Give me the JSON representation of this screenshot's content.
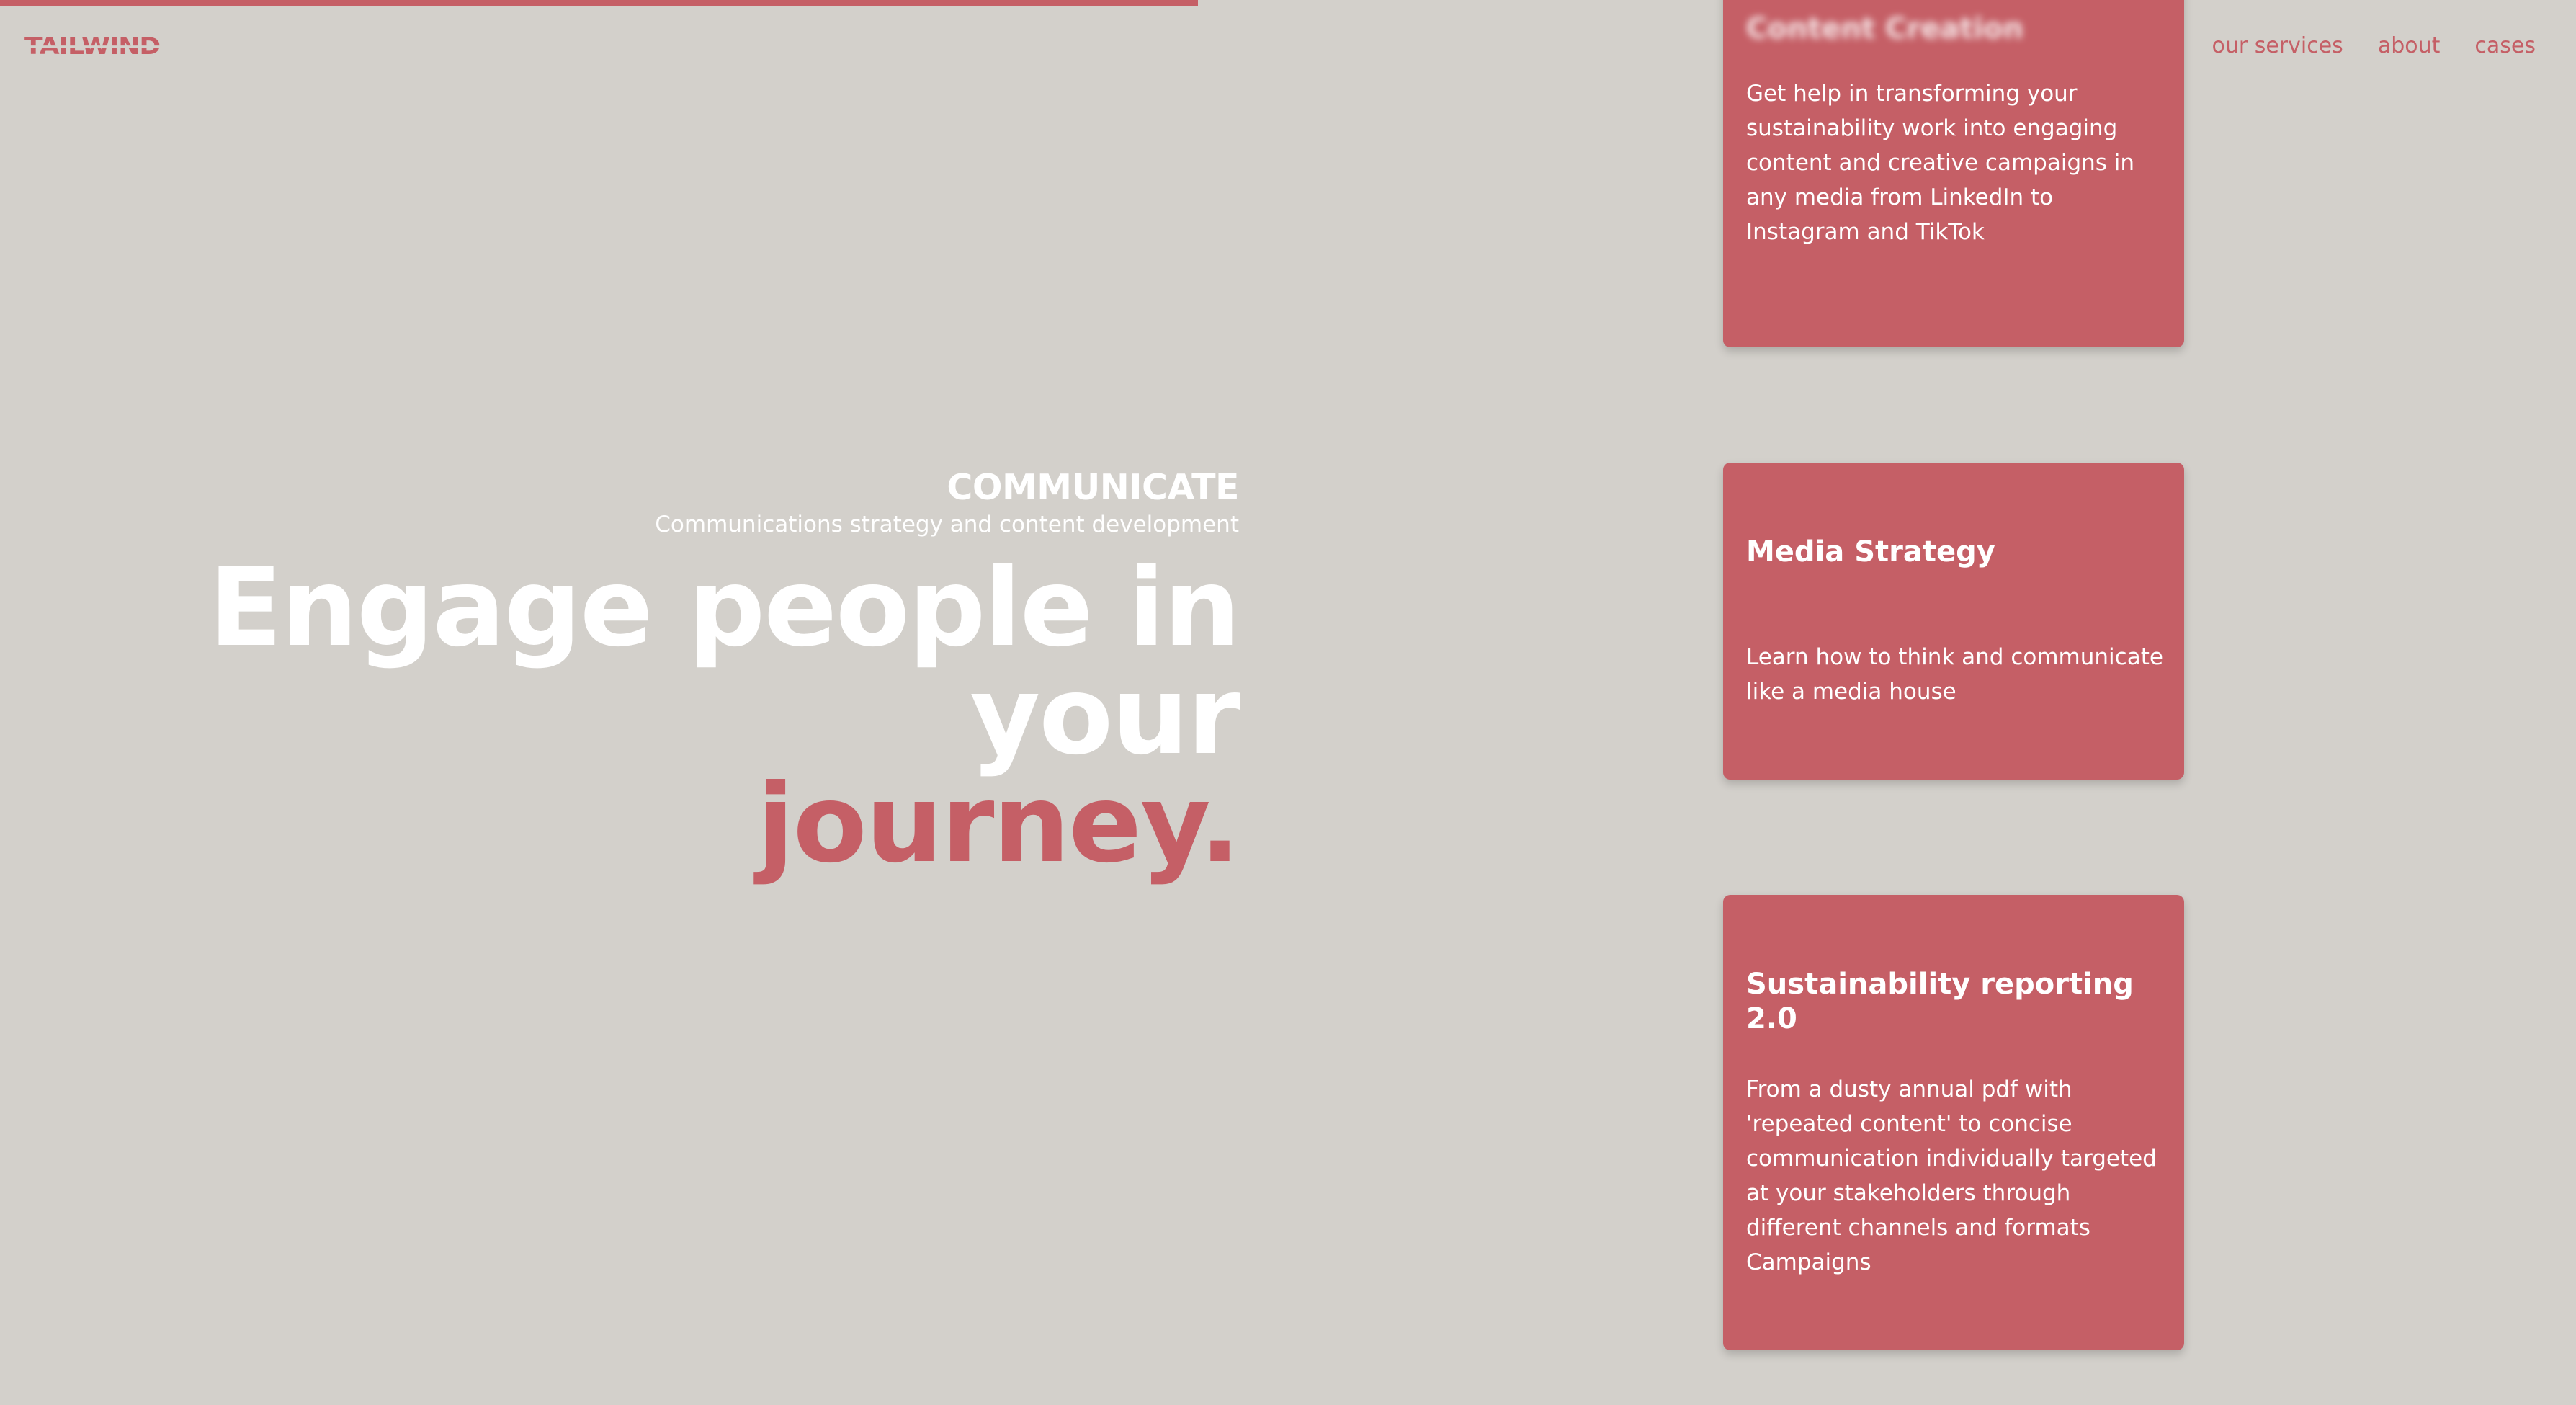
{
  "progress": {
    "value_percent": 46.5,
    "color": "#c55f66"
  },
  "header": {
    "logo": "TAILWIND",
    "nav": [
      "our services",
      "about",
      "cases"
    ]
  },
  "hero": {
    "eyebrow": "COMMUNICATE",
    "subtitle": "Communications strategy and content development",
    "headline_line1": "Engage people in your",
    "headline_accent": "journey."
  },
  "cards": [
    {
      "title": "Content Creation",
      "text": "Get help in transforming your sustainability work into engaging content and creative campaigns in any media from LinkedIn to Instagram and TikTok"
    },
    {
      "title": "Media Strategy",
      "text": "Learn how to think and communicate like a media house"
    },
    {
      "title": "Sustainability reporting 2.0",
      "text": "From a dusty annual pdf with 'repeated content' to concise communication individually targeted at your stakeholders through different channels and formats Campaigns"
    }
  ],
  "colors": {
    "background": "#d3d0cb",
    "accent": "#c55f66",
    "text_light": "#ffffff"
  }
}
